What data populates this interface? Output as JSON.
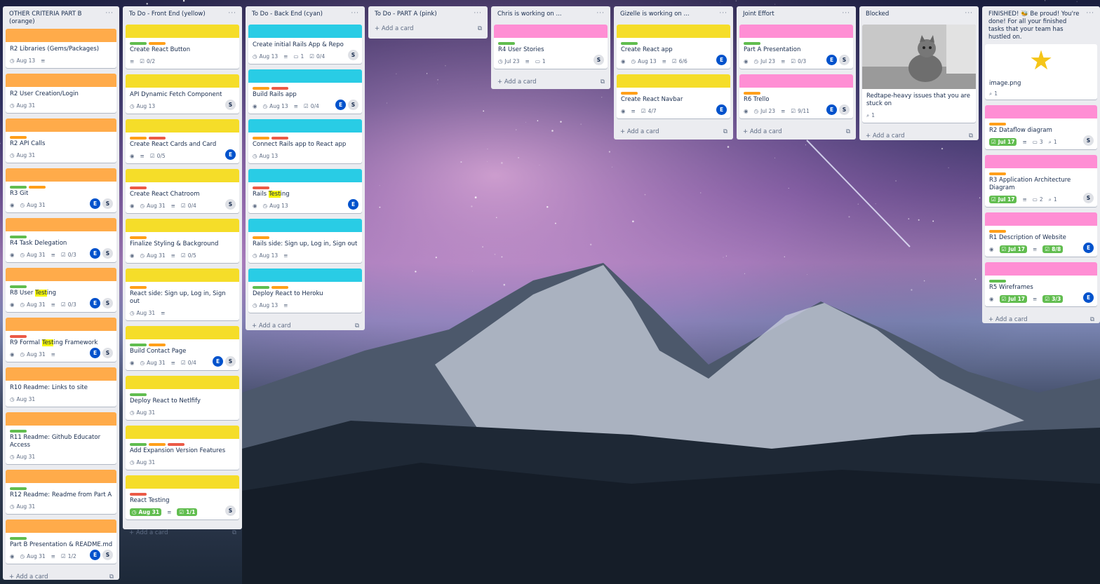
{
  "colors": {
    "orange": "#ffab4a",
    "yellow": "#f5dd29",
    "cyan": "#29cce5",
    "pink": "#ff8ed4",
    "green": "#61bd4f",
    "red": "#eb5a46",
    "label_orange": "#ff9f1a"
  },
  "ui": {
    "add_card": "Add a card",
    "menu": "···"
  },
  "lists": [
    {
      "title": "OTHER CRITERIA PART B (orange)",
      "cards": [
        {
          "title": "R2 Libraries (Gems/Packages)",
          "date": "Aug 13"
        },
        {
          "title": "R2 User Creation/Login",
          "date": "Aug 31"
        },
        {
          "title": "R2 API Calls",
          "date": "Aug 31"
        },
        {
          "title": "R3 Git",
          "date": "Aug 31"
        },
        {
          "title": "R4 Task Delegation",
          "date": "Aug 31",
          "check": "0/3"
        },
        {
          "title_a": "R8 User ",
          "title_hl": "Test",
          "title_b": "ing",
          "date": "Aug 31",
          "check": "0/3"
        },
        {
          "title_a": "R9 Formal ",
          "title_hl": "Test",
          "title_b": "ing Framework",
          "date": "Aug 31"
        },
        {
          "title": "R10 Readme: Links to site",
          "date": "Aug 31"
        },
        {
          "title": "R11 Readme: Github Educator Access",
          "date": "Aug 31"
        },
        {
          "title": "R12 Readme: Readme from Part A",
          "date": "Aug 31"
        },
        {
          "title": "Part B Presentation & README.md",
          "date": "Aug 31",
          "check": "1/2"
        }
      ]
    },
    {
      "title": "To Do - Front End (yellow)",
      "cards": [
        {
          "title": "Create React Button",
          "check": "0/2"
        },
        {
          "title": "API Dynamic Fetch Component",
          "date": "Aug 13"
        },
        {
          "title": "Create React Cards and Card",
          "check": "0/5"
        },
        {
          "title": "Create React Chatroom",
          "date": "Aug 31",
          "check": "0/4"
        },
        {
          "title": "Finalize Styling & Background",
          "date": "Aug 31",
          "check": "0/5"
        },
        {
          "title": "React side: Sign up, Log in, Sign out",
          "date": "Aug 31"
        },
        {
          "title": "Build Contact Page",
          "date": "Aug 31",
          "check": "0/4"
        },
        {
          "title": "Deploy React to Netlfify",
          "date": "Aug 31"
        },
        {
          "title": "Add Expansion Version Features",
          "date": "Aug 31"
        },
        {
          "title": "React Testing",
          "date": "Aug 31",
          "check": "1/1"
        }
      ]
    },
    {
      "title": "To Do - Back End (cyan)",
      "cards": [
        {
          "title": "Create initial Rails App & Repo",
          "date": "Aug 13",
          "comments": "1",
          "check": "0/4"
        },
        {
          "title": "Build Rails app",
          "date": "Aug 13",
          "check": "0/4"
        },
        {
          "title": "Connect Rails app to React app",
          "date": "Aug 13"
        },
        {
          "title_a": "Rails ",
          "title_hl": "Test",
          "title_b": "ing",
          "date": "Aug 13"
        },
        {
          "title": "Rails side: Sign up, Log in, Sign out",
          "date": "Aug 13"
        },
        {
          "title": "Deploy React to Heroku",
          "date": "Aug 13"
        }
      ]
    },
    {
      "title": "To Do - PART A (pink)",
      "cards": []
    },
    {
      "title": "Chris is working on ...",
      "cards": [
        {
          "title": "R4 User Stories",
          "date": "Jul 23",
          "comments": "1"
        }
      ]
    },
    {
      "title": "Gizelle is working on ...",
      "cards": [
        {
          "title": "Create React app",
          "date": "Aug 13",
          "check": "6/6"
        },
        {
          "title": "Create React Navbar",
          "check": "4/7"
        }
      ]
    },
    {
      "title": "Joint Effort",
      "cards": [
        {
          "title": "Part A Presentation",
          "date": "Jul 23",
          "check": "0/3"
        },
        {
          "title": "R6 Trello",
          "date": "Jul 23",
          "check": "9/11"
        }
      ]
    },
    {
      "title": "Blocked",
      "cards": [
        {
          "title": "Redtape-heavy issues that you are stuck on",
          "attach": "1"
        }
      ]
    },
    {
      "title": "FINISHED! 🐝 Be proud! You're done! For all your finished tasks that your team has hustled on.",
      "cards": [
        {
          "title": "image.png",
          "attach": "1"
        },
        {
          "title": "R2 Dataflow diagram",
          "date": "Jul 17",
          "comments": "3",
          "attach": "1"
        },
        {
          "title": "R3 Application Architecture Diagram",
          "date": "Jul 17",
          "comments": "2",
          "attach": "1"
        },
        {
          "title": "R1 Description of Website",
          "date": "Jul 17",
          "check": "8/8"
        },
        {
          "title": "R5 Wireframes",
          "date": "Jul 17",
          "check": "3/3"
        }
      ]
    }
  ],
  "members": {
    "e": "E",
    "s": "S"
  }
}
